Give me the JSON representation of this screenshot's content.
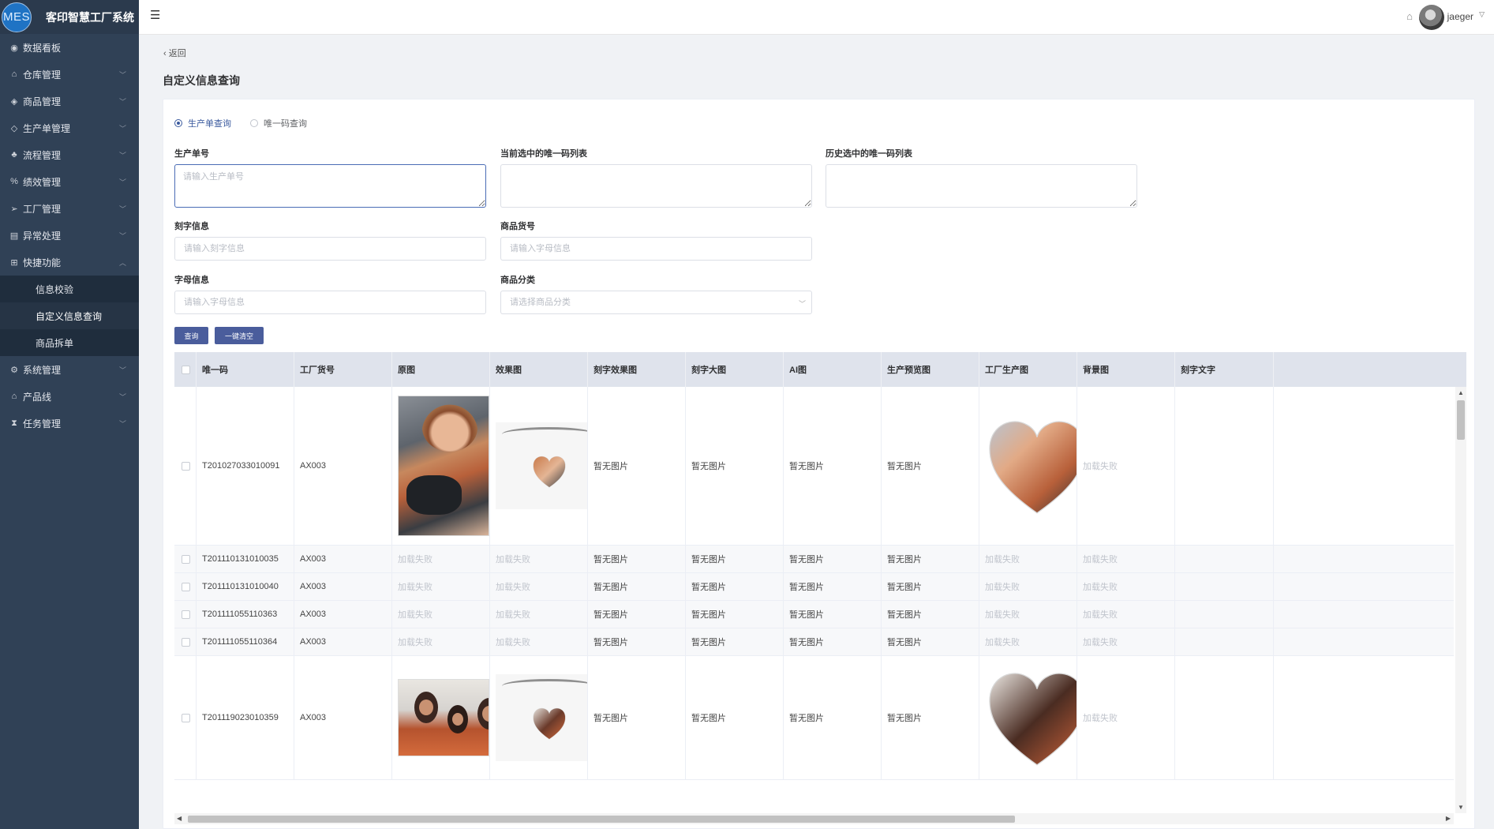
{
  "app": {
    "logo_text": "MES",
    "title": "客印智慧工厂系统"
  },
  "sidebar": {
    "items": [
      {
        "label": "数据看板",
        "icon": "dashboard-icon",
        "glyph": "◉",
        "has_children": false
      },
      {
        "label": "仓库管理",
        "icon": "home-icon",
        "glyph": "⌂",
        "has_children": true
      },
      {
        "label": "商品管理",
        "icon": "tag-icon",
        "glyph": "◈",
        "has_children": true
      },
      {
        "label": "生产单管理",
        "icon": "layers-icon",
        "glyph": "◇",
        "has_children": true
      },
      {
        "label": "流程管理",
        "icon": "sitemap-icon",
        "glyph": "♣",
        "has_children": true
      },
      {
        "label": "绩效管理",
        "icon": "percent-icon",
        "glyph": "%",
        "has_children": true
      },
      {
        "label": "工厂管理",
        "icon": "send-icon",
        "glyph": "➢",
        "has_children": true
      },
      {
        "label": "异常处理",
        "icon": "form-icon",
        "glyph": "▤",
        "has_children": true
      },
      {
        "label": "快捷功能",
        "icon": "grid-icon",
        "glyph": "⊞",
        "has_children": true,
        "expanded": true
      }
    ],
    "subitems": [
      {
        "label": "信息校验",
        "active": false
      },
      {
        "label": "自定义信息查询",
        "active": true
      },
      {
        "label": "商品拆单",
        "active": false
      }
    ],
    "items_after": [
      {
        "label": "系统管理",
        "icon": "settings-icon",
        "glyph": "⚙",
        "has_children": true
      },
      {
        "label": "产品线",
        "icon": "home-icon",
        "glyph": "⌂",
        "has_children": true
      },
      {
        "label": "任务管理",
        "icon": "hourglass-icon",
        "glyph": "⧗",
        "has_children": true
      }
    ]
  },
  "topbar": {
    "username": "jaeger"
  },
  "page": {
    "back_label": "返回",
    "title": "自定义信息查询"
  },
  "search": {
    "mode_options": [
      "生产单查询",
      "唯一码查询"
    ],
    "selected_mode": "生产单查询",
    "production_no_label": "生产单号",
    "production_no_placeholder": "请输入生产单号",
    "current_codes_label": "当前选中的唯一码列表",
    "history_codes_label": "历史选中的唯一码列表",
    "engraving_label": "刻字信息",
    "engraving_placeholder": "请输入刻字信息",
    "sku_label": "商品货号",
    "sku_placeholder": "请输入字母信息",
    "letters_label": "字母信息",
    "letters_placeholder": "请输入字母信息",
    "category_label": "商品分类",
    "category_placeholder": "请选择商品分类",
    "query_button": "查询",
    "clear_button": "一键清空"
  },
  "table": {
    "columns": [
      "唯一码",
      "工厂货号",
      "原图",
      "效果图",
      "刻字效果图",
      "刻字大图",
      "AI图",
      "生产预览图",
      "工厂生产图",
      "背景图",
      "刻字文字"
    ],
    "no_image_text": "暂无图片",
    "load_fail_text": "加载失败",
    "rows": [
      {
        "code": "T201027033010091",
        "factory_no": "AX003",
        "has_images": true,
        "photo": "a"
      },
      {
        "code": "T201110131010035",
        "factory_no": "AX003",
        "has_images": false
      },
      {
        "code": "T201110131010040",
        "factory_no": "AX003",
        "has_images": false
      },
      {
        "code": "T201111055110363",
        "factory_no": "AX003",
        "has_images": false
      },
      {
        "code": "T201111055110364",
        "factory_no": "AX003",
        "has_images": false
      },
      {
        "code": "T201119023010359",
        "factory_no": "AX003",
        "has_images": true,
        "photo": "b"
      }
    ]
  },
  "colors": {
    "sidebar_bg": "#304156",
    "primary": "#4a5d9c",
    "header_bg": "#dfe3ec"
  }
}
